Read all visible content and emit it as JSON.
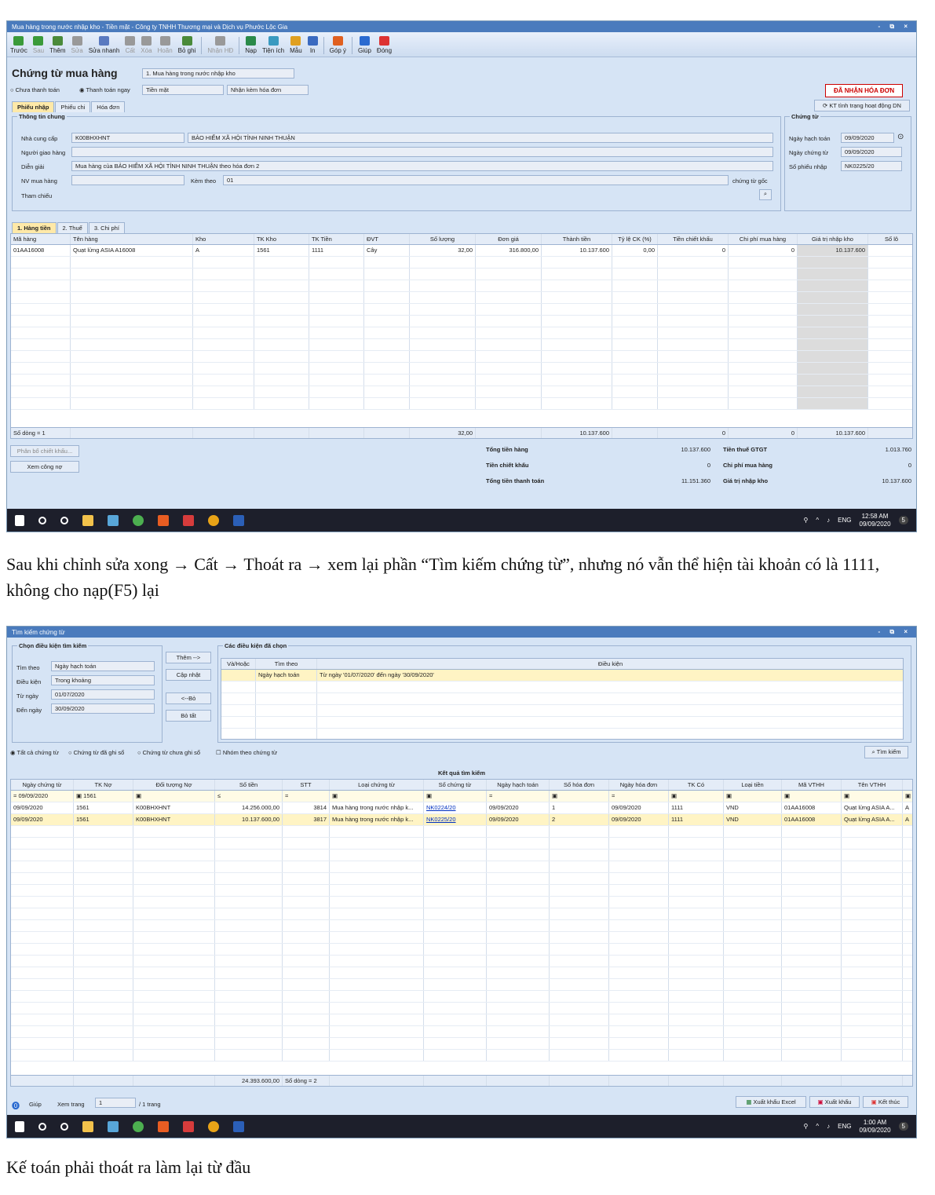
{
  "screen1": {
    "title": "Mua hàng trong nước nhập kho - Tiền mặt - Công ty TNHH Thương mại và Dịch vụ Phước Lộc Gia",
    "window_controls": "- ⧉ ×",
    "toolbar": [
      {
        "label": "Trước"
      },
      {
        "label": "Sau"
      },
      {
        "label": "Thêm"
      },
      {
        "label": "Sửa"
      },
      {
        "label": "Sửa nhanh"
      },
      {
        "label": "Cất"
      },
      {
        "label": "Xóa"
      },
      {
        "label": "Hoãn"
      },
      {
        "label": "Bỏ ghi"
      },
      {
        "label": "Nhận HĐ"
      },
      {
        "label": "Nạp"
      },
      {
        "label": "Tiện ích"
      },
      {
        "label": "Mẫu"
      },
      {
        "label": "In"
      },
      {
        "label": "Góp ý"
      },
      {
        "label": "Giúp"
      },
      {
        "label": "Đóng"
      }
    ],
    "heading": "Chứng từ mua hàng",
    "voucher_type": "1. Mua hàng trong nước nhập kho",
    "radio_unpaid": "Chưa thanh toán",
    "radio_paid": "Thanh toán ngay",
    "payment_method": "Tiền mặt",
    "invoice_mode": "Nhận kèm hóa đơn",
    "stamp": "ĐÃ NHẬN HÓA ĐƠN",
    "check_status": "KT tình trạng hoạt động DN",
    "tabs": [
      "Phiếu nhập",
      "Phiếu chi",
      "Hóa đơn"
    ],
    "general_legend": "Thông tin chung",
    "supplier_label": "Nhà cung cấp",
    "supplier_code": "K00BHXHNT",
    "supplier_name": "BẢO HIỂM XÃ HỘI TỈNH NINH THUẬN",
    "deliverer_label": "Người giao hàng",
    "desc_label": "Diễn giải",
    "desc": "Mua hàng của BẢO HIỂM XÃ HỘI TỈNH NINH THUẬN theo hóa đơn 2",
    "buyer_label": "NV mua hàng",
    "attach_label": "Kèm theo",
    "attach": "01",
    "original_label": "chứng từ gốc",
    "ref_label": "Tham chiếu",
    "voucher_legend": "Chứng từ",
    "posting_date_label": "Ngày hạch toán",
    "posting_date": "09/09/2020",
    "voucher_date_label": "Ngày chứng từ",
    "voucher_date": "09/09/2020",
    "receipt_no_label": "Số phiếu nhập",
    "receipt_no": "NK0225/20",
    "detail_tabs": [
      "1. Hàng tiền",
      "2. Thuế",
      "3. Chi phí"
    ],
    "columns": [
      "Mã hàng",
      "Tên hàng",
      "Kho",
      "TK Kho",
      "TK Tiền",
      "ĐVT",
      "Số lượng",
      "Đơn giá",
      "Thành tiền",
      "Tỷ lệ CK (%)",
      "Tiền chiết khấu",
      "Chi phí mua hàng",
      "Giá trị nhập kho",
      "Số lô"
    ],
    "rows": [
      [
        "01AA16008",
        "Quạt lửng ASIA A16008",
        "A",
        "1561",
        "1111",
        "Cây",
        "32,00",
        "316.800,00",
        "10.137.600",
        "0,00",
        "0",
        "0",
        "10.137.600",
        ""
      ]
    ],
    "footer": [
      "Số dòng = 1",
      "",
      "",
      "",
      "",
      "",
      "32,00",
      "",
      "10.137.600",
      "",
      "0",
      "0",
      "10.137.600",
      ""
    ],
    "btn_allocate": "Phân bổ chiết khấu...",
    "btn_debt": "Xem công nợ",
    "totals": [
      {
        "label": "Tổng tiền hàng",
        "value": "10.137.600",
        "label2": "Tiền thuế GTGT",
        "value2": "1.013.760"
      },
      {
        "label": "Tiền chiết khấu",
        "value": "0",
        "label2": "Chi phí mua hàng",
        "value2": "0"
      },
      {
        "label": "Tổng tiền thanh toán",
        "value": "11.151.360",
        "label2": "Giá trị nhập kho",
        "value2": "10.137.600"
      }
    ],
    "clock_time": "12:58 AM",
    "clock_date": "09/09/2020",
    "lang": "ENG",
    "notif": "5"
  },
  "caption1": "Sau khi chỉnh sửa xong → Cất → Thoát ra → xem lại phần “Tìm kiếm chứng từ”, nhưng nó vẫn thể hiện tài khoản có là 1111, không cho nạp(F5) lại",
  "screen2": {
    "title": "Tìm kiếm chứng từ",
    "window_controls": "- ⧉ ×",
    "cond_legend": "Chọn điều kiện tìm kiếm",
    "search_by_label": "Tìm theo",
    "search_by": "Ngày hạch toán",
    "cond_label": "Điều kiện",
    "cond": "Trong khoảng",
    "from_label": "Từ ngày",
    "from": "01/07/2020",
    "to_label": "Đến ngày",
    "to": "30/09/2020",
    "btn_add": "Thêm -->",
    "btn_update": "Cập nhật",
    "btn_remove": "<--Bỏ",
    "btn_remove_all": "Bỏ tất",
    "chosen_legend": "Các điều kiện đã chọn",
    "chosen_cols": [
      "Và/Hoặc",
      "Tìm theo",
      "Điều kiện"
    ],
    "chosen_row": [
      "",
      "Ngày hạch toán",
      "Từ ngày '01/07/2020' đến ngày '30/09/2020'"
    ],
    "radio_all": "Tất cả chứng từ",
    "radio_posted": "Chứng từ đã ghi sổ",
    "radio_unposted": "Chứng từ chưa ghi sổ",
    "group_label": "Nhóm theo chứng từ",
    "btn_search": "Tìm kiếm",
    "result_title": "Kết quả tìm kiếm",
    "columns": [
      "Ngày chứng từ",
      "TK Nợ",
      "Đối tượng Nợ",
      "Số tiền",
      "STT",
      "Loại chứng từ",
      "Số chứng từ",
      "Ngày hạch toán",
      "Số hóa đơn",
      "Ngày hóa đơn",
      "TK Có",
      "Loại tiền",
      "Mã VTHH",
      "Tên VTHH",
      ""
    ],
    "filter": [
      "= 09/09/2020",
      "▣ 1561",
      "▣",
      "≤",
      "=",
      "▣",
      "▣",
      "=",
      "▣",
      "=",
      "▣",
      "▣",
      "▣",
      "▣",
      "▣"
    ],
    "rows": [
      [
        "09/09/2020",
        "1561",
        "K00BHXHNT",
        "14.256.000,00",
        "3814",
        "Mua hàng trong nước nhập k...",
        "NK0224/20",
        "09/09/2020",
        "1",
        "09/09/2020",
        "1111",
        "VND",
        "01AA16008",
        "Quạt lửng ASIA A...",
        "A"
      ],
      [
        "09/09/2020",
        "1561",
        "K00BHXHNT",
        "10.137.600,00",
        "3817",
        "Mua hàng trong nước nhập k...",
        "NK0225/20",
        "09/09/2020",
        "2",
        "09/09/2020",
        "1111",
        "VND",
        "01AA16008",
        "Quạt lửng ASIA A...",
        "A"
      ]
    ],
    "sum_amount": "24.393.600,00",
    "sum_count": "Số dòng = 2",
    "help": "Giúp",
    "page_label": "Xem trang",
    "page": "1",
    "page_total": "/ 1 trang",
    "btn_excel": "Xuất khẩu Excel",
    "btn_export": "Xuất khẩu",
    "btn_close": "Kết thúc",
    "clock_time": "1:00 AM",
    "clock_date": "09/09/2020",
    "lang": "ENG",
    "notif": "5"
  },
  "caption2": "Kế toán phải thoát ra làm lại từ đầu"
}
